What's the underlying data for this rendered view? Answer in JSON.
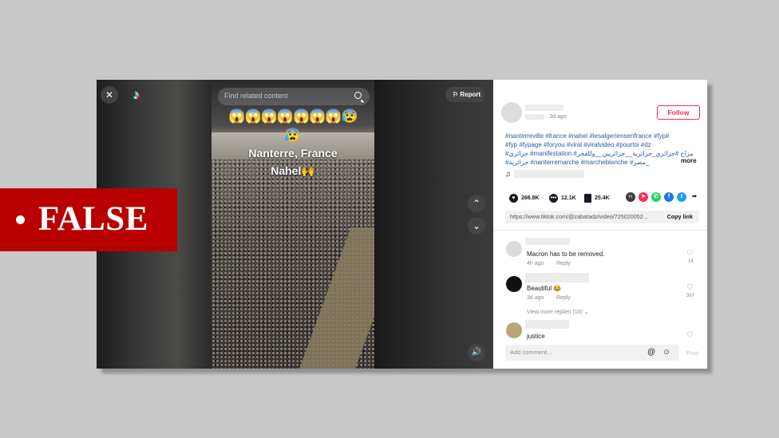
{
  "video": {
    "search_placeholder": "Find related content",
    "report_label": "Report",
    "emojis_row1": "😱😱😱😱😱😱😱😰",
    "emojis_row2": "😰",
    "caption_line1": "Nanterre, France",
    "caption_line2": "Nahel🙌"
  },
  "post": {
    "time_ago": "· 3d ago",
    "follow_label": "Follow",
    "hashtags": [
      "#nanterreville #france #nahel #lesalgeriensenfrance #fyp#",
      "#fyp #fypage #foryou #viral #viralvideo #pourtoi #dz",
      "#جزائري #manifestation #مزاح #جزائري_جزائرية__جزائريين__وللفخر",
      "#جزائرية #nanterremarche #marcheblanche #مصر_"
    ],
    "more_label": "more",
    "likes": "266.8K",
    "comments": "12.1K",
    "saves": "25.4K",
    "link": "https://www.tiktok.com/@zabatadz/video/725020052...",
    "copy_link_label": "Copy link"
  },
  "comments": [
    {
      "text": "Macron has to be removed.",
      "time": "4h ago",
      "reply": "Reply",
      "likes": "14"
    },
    {
      "text": "Beautiful 😂",
      "time": "3d ago",
      "reply": "Reply",
      "likes": "367"
    },
    {
      "text": "justice"
    }
  ],
  "view_more_replies": "View more replies (10) ⌄",
  "comment_input": {
    "placeholder": "Add comment...",
    "post_label": "Post"
  },
  "stamp": {
    "label": "FALSE"
  },
  "colors": {
    "brand_red": "#fe2c55",
    "stamp_red": "#b80000",
    "hashtag_blue": "#2b5aa8"
  }
}
